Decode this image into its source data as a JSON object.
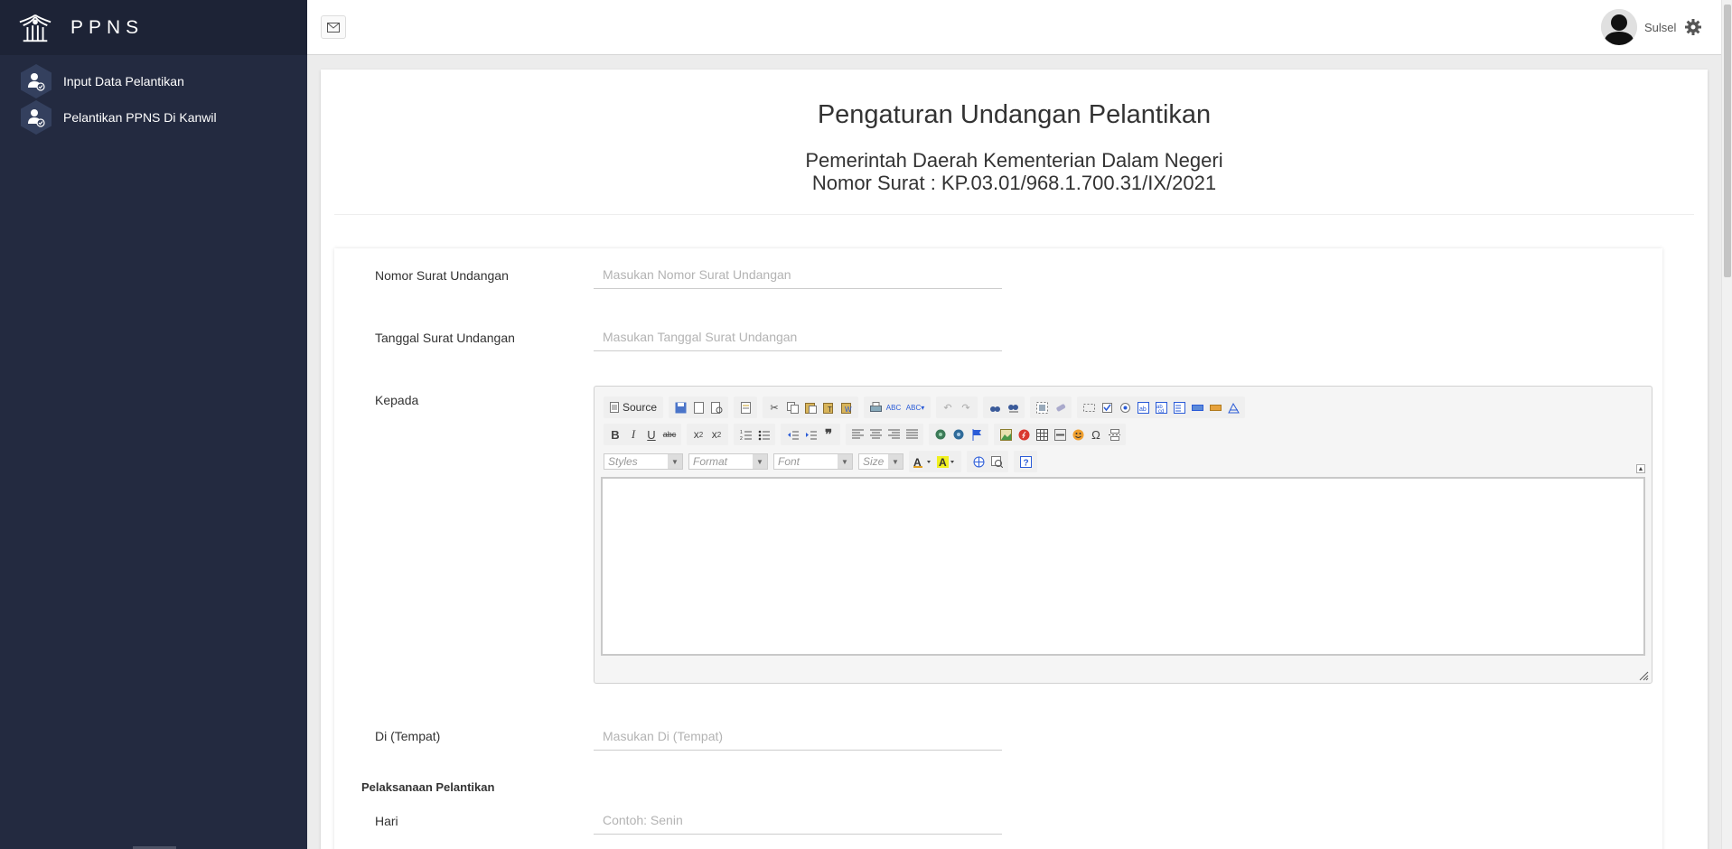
{
  "brand": {
    "name": "PPNS"
  },
  "sidebar": {
    "items": [
      {
        "label": "Input Data Pelantikan"
      },
      {
        "label": "Pelantikan PPNS Di Kanwil"
      }
    ]
  },
  "topbar": {
    "username": "Sulsel"
  },
  "page": {
    "title": "Pengaturan Undangan Pelantikan",
    "subtitle": "Pemerintah Daerah Kementerian Dalam Negeri",
    "nomor_surat": "Nomor Surat : KP.03.01/968.1.700.31/IX/2021"
  },
  "form": {
    "nomor_surat_label": "Nomor Surat Undangan",
    "nomor_surat_placeholder": "Masukan Nomor Surat Undangan",
    "tanggal_label": "Tanggal Surat Undangan",
    "tanggal_placeholder": "Masukan Tanggal Surat Undangan",
    "kepada_label": "Kepada",
    "tempat_label": "Di (Tempat)",
    "tempat_placeholder": "Masukan Di (Tempat)",
    "pelaksanaan_heading": "Pelaksanaan Pelantikan",
    "hari_label": "Hari",
    "hari_placeholder": "Contoh: Senin"
  },
  "editor": {
    "source_label": "Source",
    "styles_label": "Styles",
    "format_label": "Format",
    "font_label": "Font",
    "size_label": "Size"
  }
}
